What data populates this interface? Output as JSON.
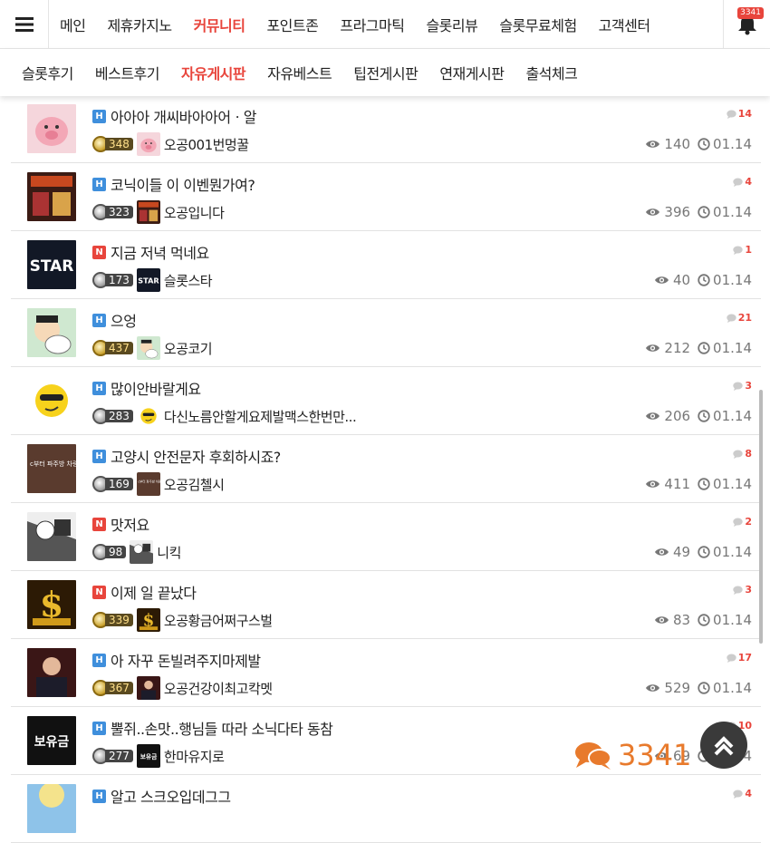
{
  "topnav": {
    "items": [
      "메인",
      "제휴카지노",
      "커뮤니티",
      "포인트존",
      "프라그마틱",
      "슬롯리뷰",
      "슬롯무료체험",
      "고객센터"
    ],
    "active_index": 2,
    "notification_count": "3341"
  },
  "subnav": {
    "items": [
      "슬롯후기",
      "베스트후기",
      "자유게시판",
      "자유베스트",
      "팁전게시판",
      "연재게시판",
      "출석체크"
    ],
    "active_index": 2
  },
  "posts": [
    {
      "badge": "H",
      "title": "아아아 개씨바아아어ㆍ알",
      "comments": "14",
      "level": "348",
      "nick": "오공001번멍꿀",
      "views": "140",
      "date": "01.14",
      "thumb": "pig"
    },
    {
      "badge": "H",
      "title": "코닉이들 이 이벤뭔가여?",
      "comments": "4",
      "level": "323",
      "nick": "오공입니다",
      "views": "396",
      "date": "01.14",
      "thumb": "poster"
    },
    {
      "badge": "N",
      "title": "지금 저녁 먹네요",
      "comments": "1",
      "level": "173",
      "nick": "슬롯스타",
      "views": "40",
      "date": "01.14",
      "thumb": "star"
    },
    {
      "badge": "H",
      "title": "으엉",
      "comments": "21",
      "level": "437",
      "nick": "오공코기",
      "views": "212",
      "date": "01.14",
      "thumb": "cartoon"
    },
    {
      "badge": "H",
      "title": "많이안바랄게요",
      "comments": "3",
      "level": "283",
      "nick": "다신노름안할게요제발맥스한번만...",
      "views": "206",
      "date": "01.14",
      "thumb": "emoji"
    },
    {
      "badge": "H",
      "title": "고양시 안전문자 후회하시죠?",
      "comments": "8",
      "level": "169",
      "nick": "오공김첼시",
      "views": "411",
      "date": "01.14",
      "thumb": "text"
    },
    {
      "badge": "N",
      "title": "맛저요",
      "comments": "2",
      "level": "98",
      "nick": "니킥",
      "views": "49",
      "date": "01.14",
      "thumb": "manga"
    },
    {
      "badge": "N",
      "title": "이제 일 끝났다",
      "comments": "3",
      "level": "339",
      "nick": "오공황금어쩌구스벌",
      "views": "83",
      "date": "01.14",
      "thumb": "gold"
    },
    {
      "badge": "H",
      "title": "아 자꾸 돈빌려주지마제발",
      "comments": "17",
      "level": "367",
      "nick": "오공건강이최고칵멧",
      "views": "529",
      "date": "01.14",
      "thumb": "person"
    },
    {
      "badge": "H",
      "title": "뿔쥐..손맛..행님들 따라 소닉다타 동참",
      "comments": "10",
      "level": "277",
      "nick": "한마유지로",
      "views": "69",
      "date": "01.14",
      "thumb": "boyugeum"
    },
    {
      "badge": "H",
      "title": "알고 스크오입데그그",
      "comments": "4",
      "level": "",
      "nick": "",
      "views": "",
      "date": "",
      "thumb": "blue"
    }
  ],
  "floating_comment_count": "3341",
  "thumb_labels": {
    "star": "STAR",
    "boyugeum": "보유금",
    "text": "c부터 파주방 차량정체중, 니"
  },
  "colors": {
    "accent": "#e8453c",
    "hot_badge": "#3f8fdc",
    "new_badge": "#e8453c",
    "float_count": "#e87a2c"
  },
  "icons": {
    "menu": "hamburger-icon",
    "bell": "bell-icon",
    "views": "eye-icon",
    "date": "clock-icon",
    "comments": "speech-bubble-icon",
    "scroll_top": "chevron-up-icon"
  }
}
